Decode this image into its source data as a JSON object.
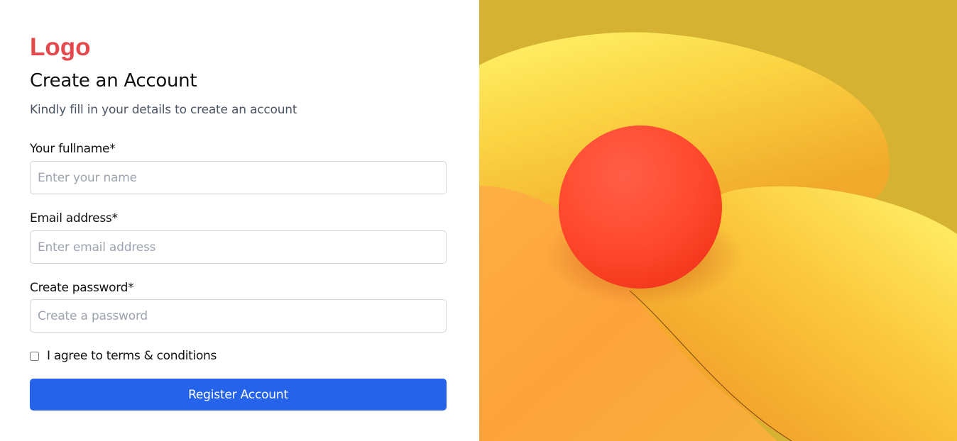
{
  "brand": {
    "logo_text": "Logo",
    "logo_color": "#e5484d"
  },
  "form": {
    "title": "Create an Account",
    "subtitle": "Kindly fill in your details to create an account",
    "fullname": {
      "label": "Your fullname*",
      "placeholder": "Enter your name",
      "value": ""
    },
    "email": {
      "label": "Email address*",
      "placeholder": "Enter email address",
      "value": ""
    },
    "password": {
      "label": "Create password*",
      "placeholder": "Create a password",
      "value": ""
    },
    "terms": {
      "label": "I agree to terms & conditions",
      "checked": false
    },
    "submit_label": "Register Account"
  },
  "colors": {
    "accent": "#2563eb",
    "logo": "#e5484d",
    "hero_background": "#d6b232",
    "hero_sphere": "#ff4a2e"
  },
  "hero": {
    "icon": "abstract-3d-illustration"
  }
}
